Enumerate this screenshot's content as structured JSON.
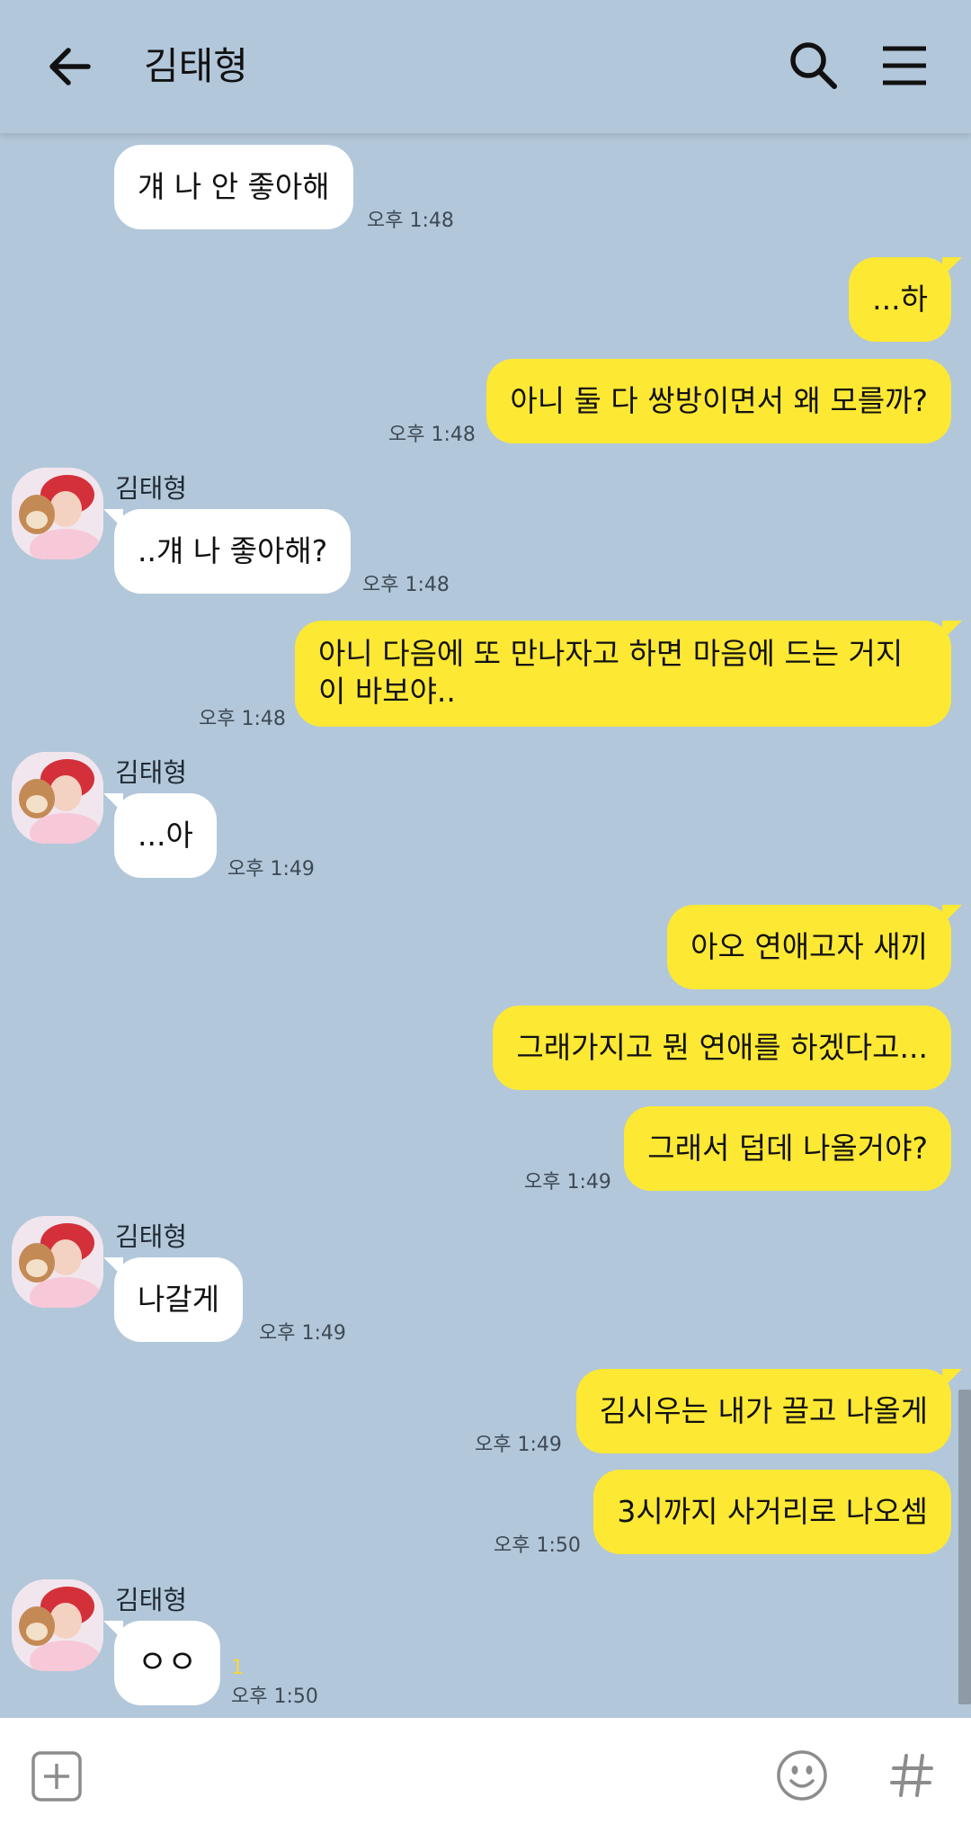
{
  "header": {
    "title": "김태형"
  },
  "contact": {
    "name": "김태형"
  },
  "messages": [
    {
      "text": "걔 나 안 좋아해",
      "time": "오후 1:48"
    },
    {
      "text": "...하"
    },
    {
      "text": "아니 둘 다 쌍방이면서 왜 모를까?",
      "time": "오후 1:48"
    },
    {
      "text": "..걔 나 좋아해?",
      "time": "오후 1:48"
    },
    {
      "text": "아니 다음에 또 만나자고 하면 마음에 드는 거지\n이 바보야..",
      "time": "오후 1:48"
    },
    {
      "text": "...아",
      "time": "오후 1:49"
    },
    {
      "text": "아오 연애고자 새끼"
    },
    {
      "text": "그래가지고 뭔 연애를 하겠다고..."
    },
    {
      "text": "그래서 덥데 나올거야?",
      "time": "오후 1:49"
    },
    {
      "text": "나갈게",
      "time": "오후 1:49"
    },
    {
      "text": "김시우는 내가 끌고 나올게",
      "time": "오후 1:49"
    },
    {
      "text": "3시까지 사거리로 나오셈",
      "time": "오후 1:50"
    },
    {
      "text": "ㅇㅇ",
      "time": "오후 1:50",
      "unread": "1"
    }
  ],
  "colors": {
    "background": "#b2c7da",
    "my_bubble": "#fde834",
    "their_bubble": "#ffffff"
  },
  "icons": [
    "back-arrow-icon",
    "search-icon",
    "menu-icon",
    "plus-icon",
    "emoji-icon",
    "hash-icon"
  ]
}
